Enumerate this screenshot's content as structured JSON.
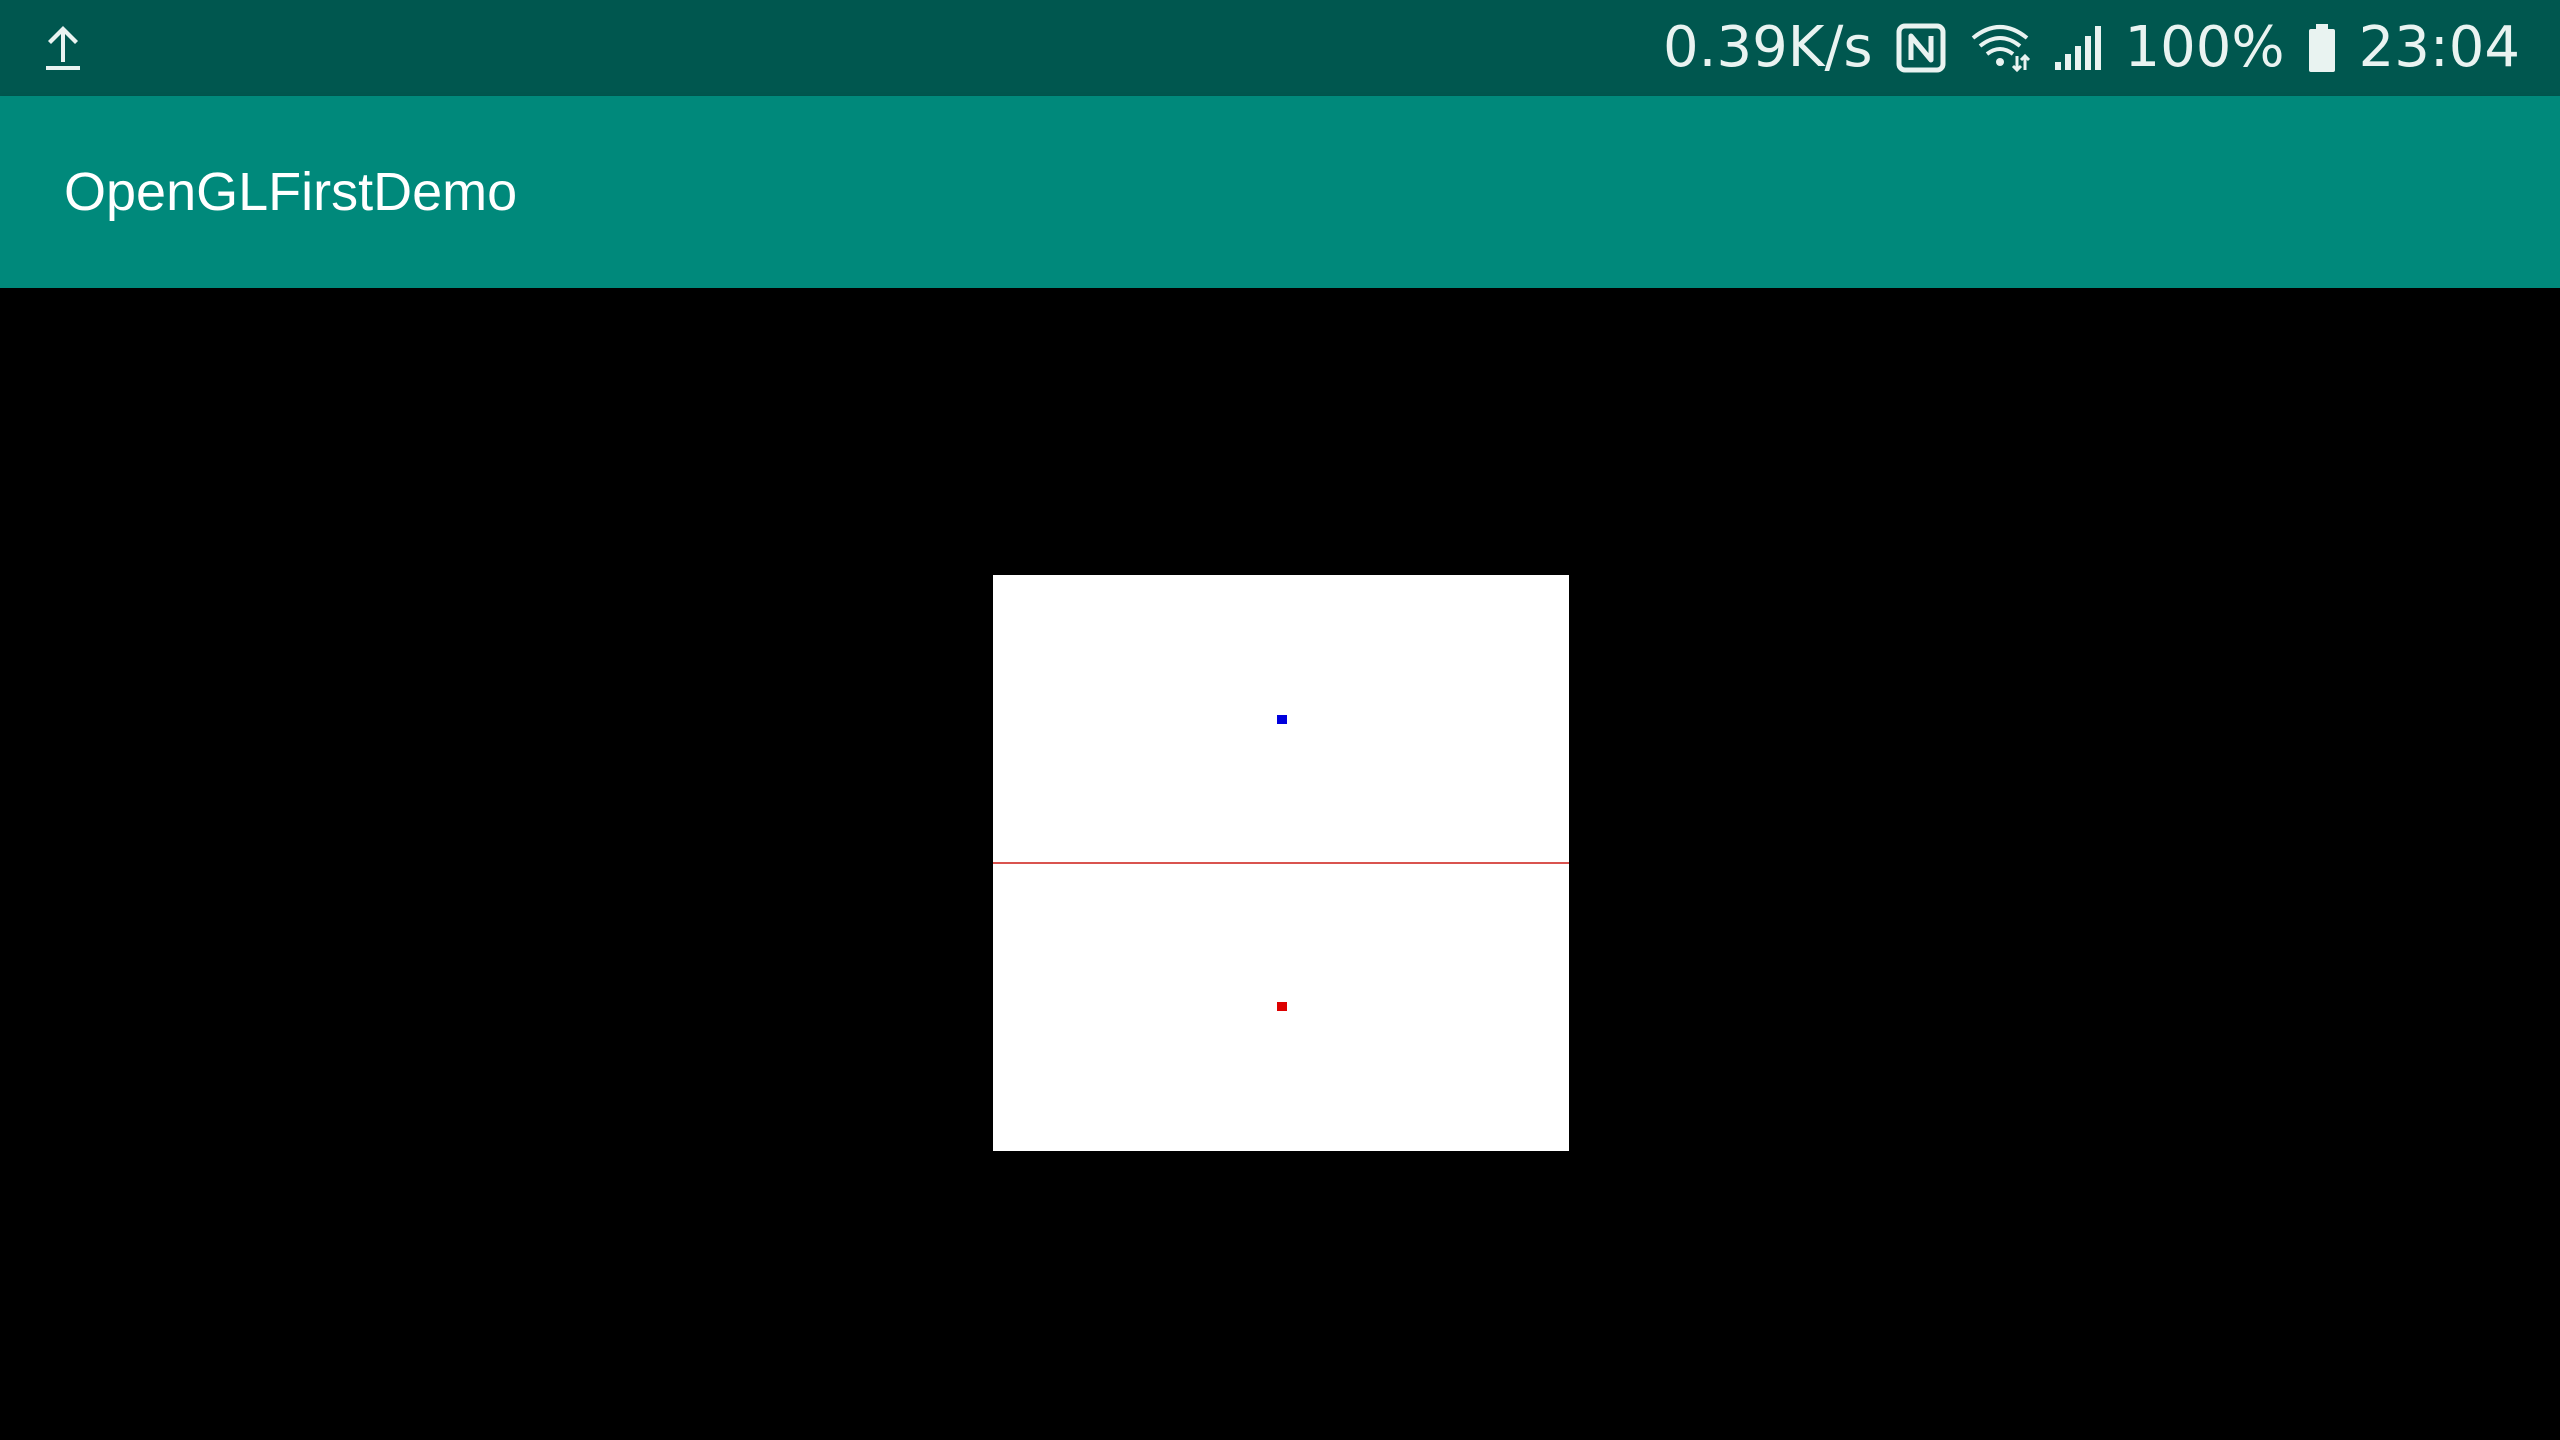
{
  "status_bar": {
    "network_speed": "0.39K/s",
    "battery_percent": "100%",
    "time": "23:04",
    "icons": [
      "upload-icon",
      "nfc-icon",
      "wifi-icon",
      "signal-icon",
      "battery-icon"
    ],
    "background_color": "#00574f"
  },
  "app_bar": {
    "title": "OpenGLFirstDemo",
    "background_color": "#00897b"
  },
  "content": {
    "background_color": "#000000",
    "canvas_color": "#ffffff",
    "line": {
      "color": "#d9534f",
      "orientation": "horizontal"
    },
    "points": [
      {
        "name": "blue-point",
        "color": "#0000dd"
      },
      {
        "name": "red-point",
        "color": "#dd0000"
      }
    ]
  }
}
